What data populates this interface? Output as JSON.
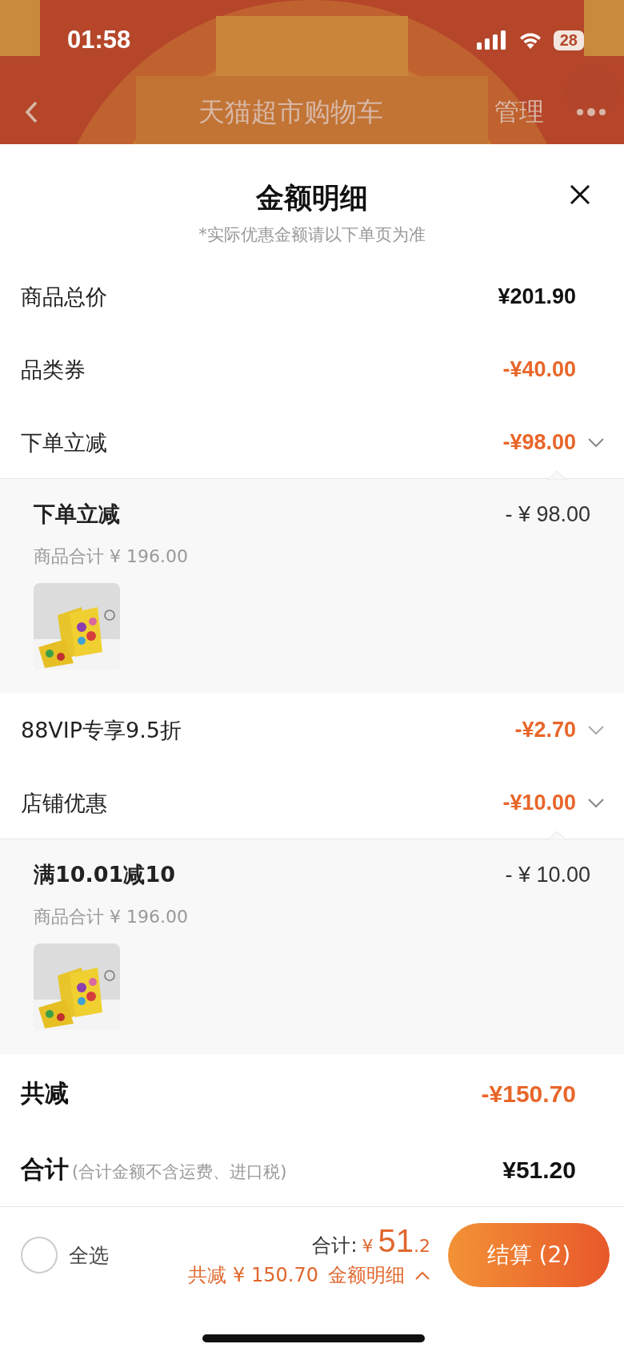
{
  "status_bar": {
    "time": "01:58",
    "battery": "28"
  },
  "nav": {
    "title": "天猫超市购物车",
    "action": "管理"
  },
  "sheet": {
    "title": "金额明细",
    "note": "*实际优惠金额请以下单页为准",
    "rows": [
      {
        "label": "商品总价",
        "amount": "¥201.90",
        "kind": "price"
      },
      {
        "label": "品类券",
        "amount": "-¥40.00",
        "kind": "discount"
      },
      {
        "label": "下单立减",
        "amount": "-¥98.00",
        "kind": "discount",
        "expanded": true,
        "detail": {
          "title": "下单立减",
          "amount": "- ¥ 98.00",
          "subtotal": "商品合计 ¥ 196.00"
        }
      },
      {
        "label": "88VIP专享9.5折",
        "amount": "-¥2.70",
        "kind": "discount",
        "expanded": false
      },
      {
        "label": "店铺优惠",
        "amount": "-¥10.00",
        "kind": "discount",
        "expanded": true,
        "detail": {
          "title": "满10.01减10",
          "amount": "- ¥ 10.00",
          "subtotal": "商品合计 ¥ 196.00"
        }
      }
    ],
    "saved": {
      "label": "共减",
      "amount": "-¥150.70"
    },
    "total": {
      "label": "合计",
      "note": "(合计金额不含运费、进口税)",
      "amount": "¥51.20"
    }
  },
  "footer": {
    "select_all": {
      "label": "全选",
      "checked": false
    },
    "total_label": "合计:",
    "currency": "¥",
    "total_int": "51",
    "total_dec": ".2",
    "savings": "共减 ¥ 150.70",
    "detail_link": "金额明细",
    "checkout": "结算 (2)"
  }
}
